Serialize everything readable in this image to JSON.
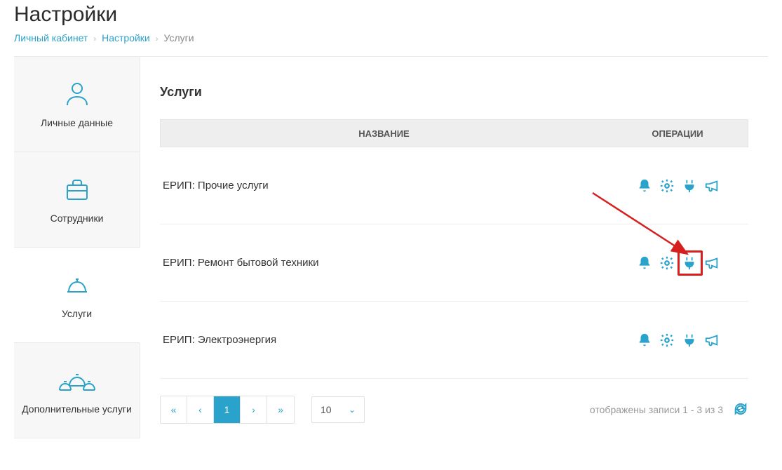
{
  "header": {
    "title": "Настройки"
  },
  "breadcrumb": {
    "items": [
      "Личный кабинет",
      "Настройки",
      "Услуги"
    ]
  },
  "sidebar": {
    "items": [
      {
        "label": "Личные данные",
        "icon": "user",
        "active": false
      },
      {
        "label": "Сотрудники",
        "icon": "briefcase",
        "active": false
      },
      {
        "label": "Услуги",
        "icon": "service-bell",
        "active": true
      },
      {
        "label": "Дополнительные услуги",
        "icon": "multi-bell",
        "active": false
      }
    ]
  },
  "section": {
    "title": "Услуги"
  },
  "table": {
    "columns": {
      "name": "НАЗВАНИЕ",
      "operations": "ОПЕРАЦИИ"
    },
    "rows": [
      {
        "name": "ЕРИП: Прочие услуги"
      },
      {
        "name": "ЕРИП: Ремонт бытовой техники"
      },
      {
        "name": "ЕРИП: Электроэнергия"
      }
    ]
  },
  "pagination": {
    "page": "1",
    "page_size": "10",
    "summary": "отображены записи 1 - 3 из 3"
  },
  "icons": {
    "accent": "#29a3cb"
  }
}
